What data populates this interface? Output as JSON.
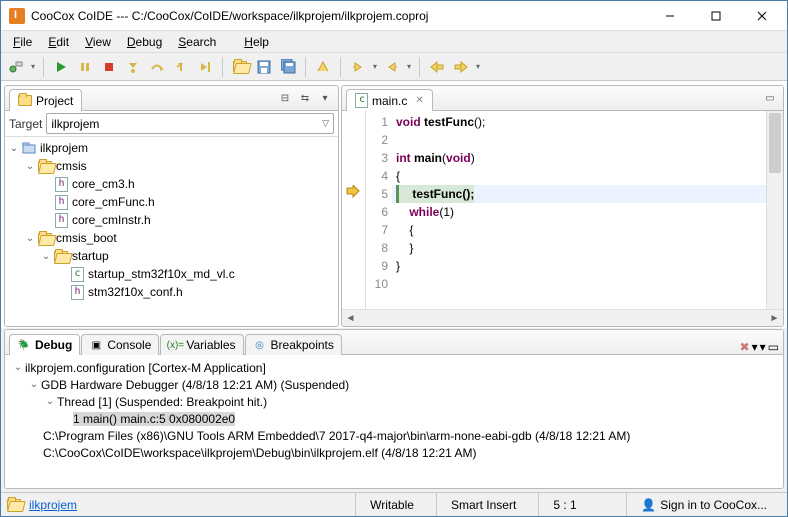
{
  "title": "CooCox CoIDE --- C:/CooCox/CoIDE/workspace/ilkprojem/ilkprojem.coproj",
  "menu": {
    "file": "File",
    "edit": "Edit",
    "view": "View",
    "debug": "Debug",
    "search": "Search",
    "help": "Help"
  },
  "project": {
    "tab": "Project",
    "target_label": "Target",
    "target_value": "ilkprojem",
    "tree": {
      "root": "ilkprojem",
      "cmsis": "cmsis",
      "core_cm3": "core_cm3.h",
      "core_cmFunc": "core_cmFunc.h",
      "core_cmInstr": "core_cmInstr.h",
      "cmsis_boot": "cmsis_boot",
      "startup": "startup",
      "startup_file": "startup_stm32f10x_md_vl.c",
      "conf_file": "stm32f10x_conf.h"
    }
  },
  "editor": {
    "tab": "main.c",
    "lines": {
      "l1_void": "void ",
      "l1_fn": "testFunc",
      "l1_rest": "();",
      "l3_int": "int ",
      "l3_main": "main",
      "l3_paren_open": "(",
      "l3_void": "void",
      "l3_paren_close": ")",
      "l4": "{",
      "l5_indent": "    ",
      "l5_call": "testFunc();",
      "l6_indent": "    ",
      "l6_while": "while",
      "l6_rest": "(1)",
      "l7": "    {",
      "l8": "    }",
      "l9": "}"
    },
    "linenos": [
      "1",
      "2",
      "3",
      "4",
      "5",
      "6",
      "7",
      "8",
      "9",
      "10"
    ]
  },
  "bottom_tabs": {
    "debug": "Debug",
    "console": "Console",
    "variables": "Variables",
    "breakpoints": "Breakpoints"
  },
  "debug": {
    "config": "ilkprojem.configuration [Cortex-M Application]",
    "gdb": "GDB Hardware Debugger (4/8/18 12:21 AM) (Suspended)",
    "thread": "Thread [1] (Suspended: Breakpoint hit.)",
    "frame": "1 main() main.c:5 0x080002e0",
    "path1": "C:\\Program Files (x86)\\GNU Tools ARM Embedded\\7 2017-q4-major\\bin\\arm-none-eabi-gdb (4/8/18 12:21 AM)",
    "path2": "C:\\CooCox\\CoIDE\\workspace\\ilkprojem\\Debug\\bin\\ilkprojem.elf (4/8/18 12:21 AM)"
  },
  "status": {
    "project_link": "ilkprojem",
    "writable": "Writable",
    "insert": "Smart Insert",
    "pos": "5 : 1",
    "signin": "Sign in to CooCox..."
  }
}
